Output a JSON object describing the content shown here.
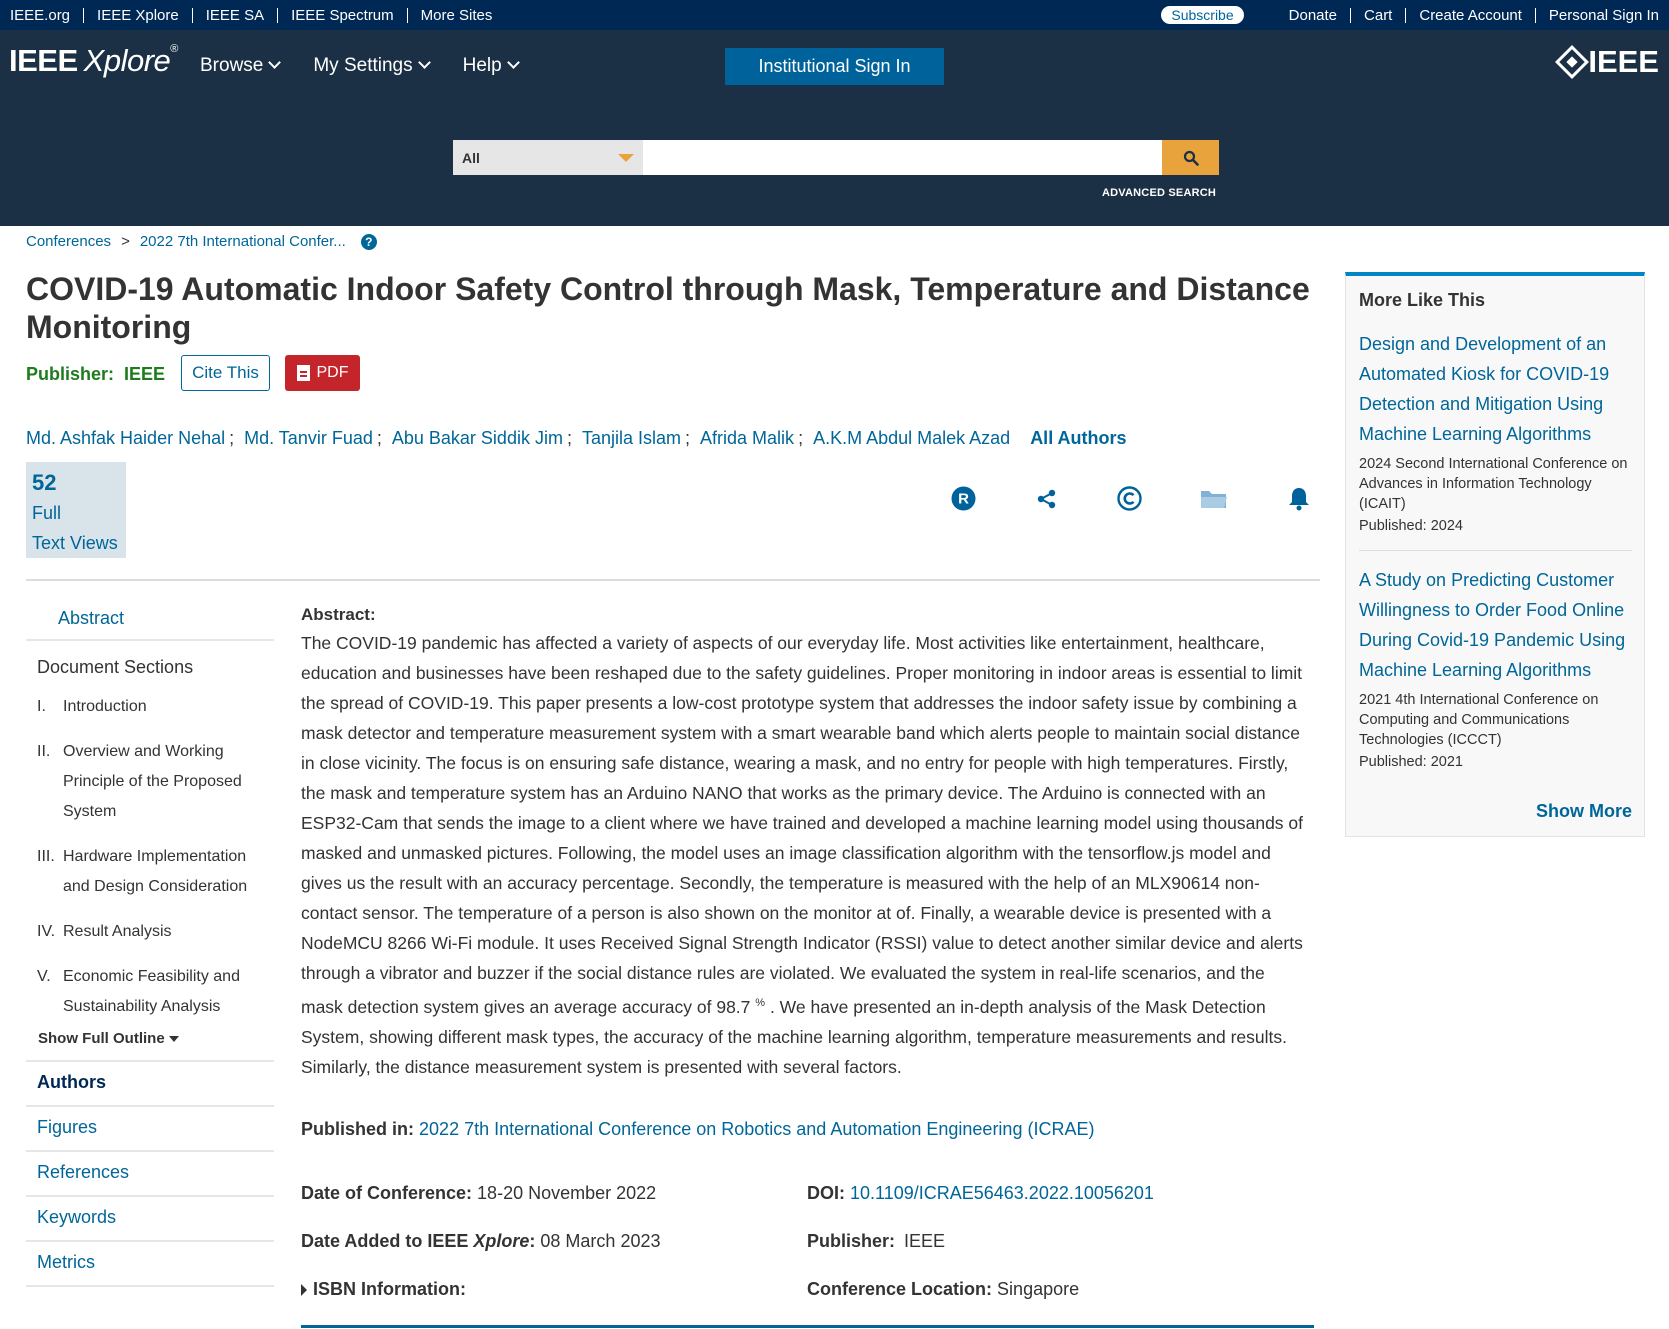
{
  "topbar": {
    "links": [
      "IEEE.org",
      "IEEE Xplore",
      "IEEE SA",
      "IEEE Spectrum",
      "More Sites"
    ],
    "subscribe": "Subscribe",
    "right_links": [
      "Donate",
      "Cart",
      "Create Account",
      "Personal Sign In"
    ]
  },
  "header": {
    "logo_ieee": "IEEE",
    "logo_xplore": "Xplore",
    "logo_reg": "®",
    "nav": [
      "Browse",
      "My Settings",
      "Help"
    ],
    "institutional_sign_in": "Institutional Sign In",
    "brand": "IEEE"
  },
  "search": {
    "scope": "All",
    "value": "",
    "advanced": "ADVANCED SEARCH"
  },
  "breadcrumb": {
    "items": [
      "Conferences",
      "2022 7th International Confer..."
    ],
    "separator": ">",
    "help": "?"
  },
  "article": {
    "title": "COVID-19 Automatic Indoor Safety Control through Mask, Temperature and Distance Monitoring",
    "publisher_label": "Publisher:",
    "publisher": "IEEE",
    "cite_this": "Cite This",
    "pdf": "PDF",
    "authors": [
      "Md. Ashfak Haider Nehal",
      "Md. Tanvir Fuad",
      "Abu Bakar Siddik Jim",
      "Tanjila Islam",
      "Afrida Malik",
      "A.K.M Abdul Malek Azad"
    ],
    "author_sep": ";",
    "all_authors": "All Authors",
    "views_count": "52",
    "views_label_1": "Full",
    "views_label_2": "Text Views"
  },
  "tools": {
    "icons": [
      "rights-icon",
      "share-icon",
      "copyright-icon",
      "folder-icon",
      "alert-bell-icon"
    ],
    "rights_letter": "R"
  },
  "leftnav": {
    "abstract": "Abstract",
    "document_sections": "Document Sections",
    "sections": [
      {
        "num": "I.",
        "label": "Introduction"
      },
      {
        "num": "II.",
        "label": "Overview and Working Principle of the Proposed System"
      },
      {
        "num": "III.",
        "label": "Hardware Implementation and Design Consideration"
      },
      {
        "num": "IV.",
        "label": "Result Analysis"
      },
      {
        "num": "V.",
        "label": "Economic Feasibility and Sustainability Analysis"
      }
    ],
    "show_full_outline": "Show Full Outline",
    "links": [
      "Authors",
      "Figures",
      "References",
      "Keywords",
      "Metrics"
    ]
  },
  "abstract": {
    "label": "Abstract:",
    "text_1": "The COVID-19 pandemic has affected a variety of aspects of our everyday life. Most activities like entertainment, healthcare, education and businesses have been reshaped due to the safety guidelines. Proper monitoring in indoor areas is essential to limit the spread of COVID-19. This paper presents a low-cost prototype system that addresses the indoor safety issue by combining a mask detector and temperature measurement system with a smart wearable band which alerts people to maintain social distance in close vicinity. The focus is on ensuring safe distance, wearing a mask, and no entry for people with high temperatures. Firstly, the mask and temperature system has an Arduino NANO that works as the primary device. The Arduino is connected with an ESP32-Cam that sends the image to a client where we have trained and developed a machine learning model using thousands of masked and unmasked pictures. Following, the model uses an image classification algorithm with the tensorflow.js model and gives us the result with an accuracy percentage. Secondly, the temperature is measured with the help of an MLX90614 non-contact sensor. The temperature of a person is also shown on the monitor at of. Finally, a wearable device is presented with a NodeMCU 8266 Wi-Fi module. It uses Received Signal Strength Indicator (RSSI) value to detect another similar device and alerts through a vibrator and buzzer if the social distance rules are violated. We evaluated the system in real-life scenarios, and the mask detection system gives an average accuracy of 98.7",
    "percent": "%",
    "text_2": ". We have presented an in-depth analysis of the Mask Detection System, showing different mask types, the accuracy of the machine learning algorithm, temperature measurements and results. Similarly, the distance measurement system is presented with several factors."
  },
  "details": {
    "published_in_label": "Published in:",
    "published_in": "2022 7th International Conference on Robotics and Automation Engineering (ICRAE)",
    "date_conf_label": "Date of Conference:",
    "date_conf": "18-20 November 2022",
    "date_added_label_1": "Date Added to IEEE",
    "date_added_label_2": "Xplore",
    "date_added_label_3": ":",
    "date_added": "08 March 2023",
    "isbn_label": "ISBN Information:",
    "doi_label": "DOI:",
    "doi": "10.1109/ICRAE56463.2022.10056201",
    "publisher_label": "Publisher:",
    "publisher": "IEEE",
    "location_label": "Conference Location:",
    "location": "Singapore"
  },
  "sidebar": {
    "heading": "More Like This",
    "articles": [
      {
        "title": "Design and Development of an Automated Kiosk for COVID-19 Detection and Mitigation Using Machine Learning Algorithms",
        "conference": "2024 Second International Conference on Advances in Information Technology (ICAIT)",
        "published": "Published: 2024"
      },
      {
        "title": "A Study on Predicting Customer Willingness to Order Food Online During Covid-19 Pandemic Using Machine Learning Algorithms",
        "conference": "2021 4th International Conference on Computing and Communications Technologies (ICCCT)",
        "published": "Published: 2021"
      }
    ],
    "show_more": "Show More"
  },
  "colors": {
    "topbar": "#002855",
    "header": "#1b3044",
    "accent": "#006699",
    "search_button": "#e8a33d",
    "pdf": "#c4252b",
    "publisher_green": "#1e7b1e"
  }
}
